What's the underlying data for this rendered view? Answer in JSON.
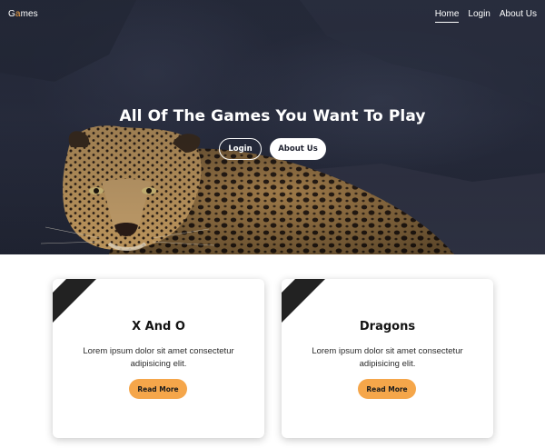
{
  "brand": {
    "first": "G",
    "accent": "a",
    "rest": "mes"
  },
  "nav": {
    "items": [
      {
        "label": "Home"
      },
      {
        "label": "Login"
      },
      {
        "label": "About Us"
      }
    ]
  },
  "hero": {
    "title": "All Of The Games You Want To Play",
    "buttons": {
      "login": "Login",
      "about": "About Us"
    }
  },
  "cards": [
    {
      "title": "X And O",
      "text": "Lorem ipsum dolor sit amet consectetur adipisicing elit.",
      "button": "Read More"
    },
    {
      "title": "Dragons",
      "text": "Lorem ipsum dolor sit amet consectetur adipisicing elit.",
      "button": "Read More"
    }
  ],
  "colors": {
    "accent": "#f5a64a",
    "hero_dark": "#272c3c",
    "card_corner": "#222222"
  },
  "icons": {
    "hero_image": "leopard-photo"
  }
}
